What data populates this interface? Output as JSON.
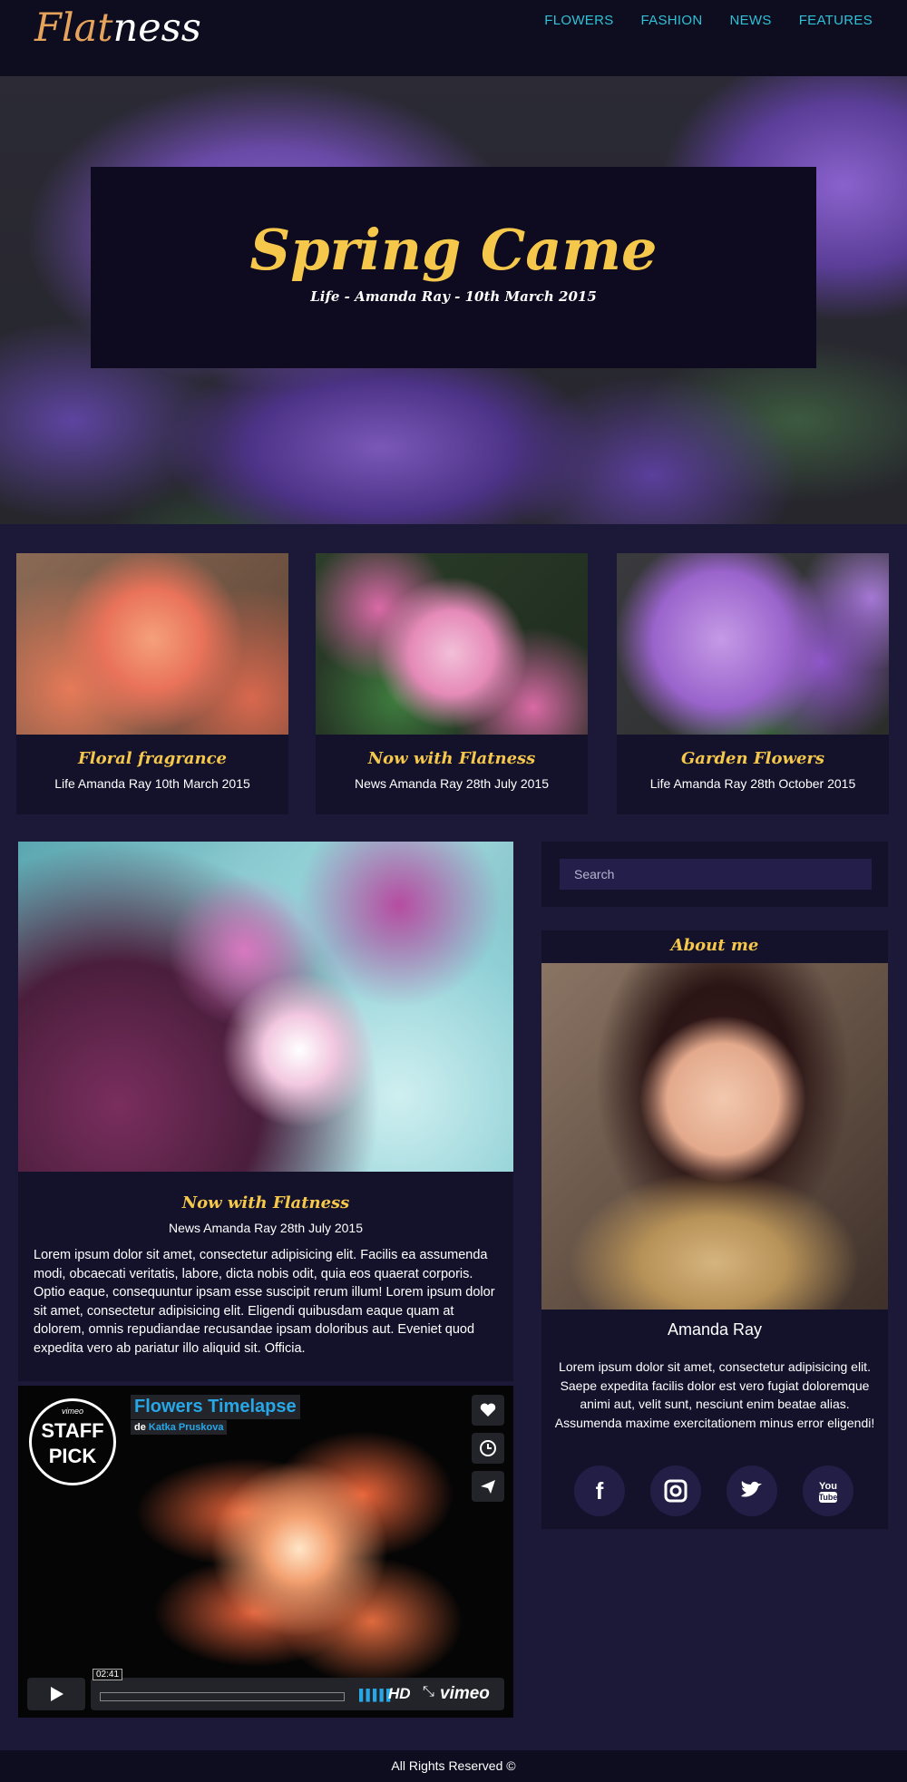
{
  "header": {
    "logo_part1": "Flat",
    "logo_part2": "ness",
    "nav": [
      "FLOWERS",
      "FASHION",
      "NEWS",
      "FEATURES"
    ]
  },
  "hero": {
    "title": "Spring Came",
    "subtitle": "Life - Amanda Ray - 10th March 2015"
  },
  "cards": [
    {
      "title": "Floral fragrance",
      "meta": "Life Amanda Ray 10th March 2015"
    },
    {
      "title": "Now with Flatness",
      "meta": "News Amanda Ray 28th July 2015"
    },
    {
      "title": "Garden Flowers",
      "meta": "Life Amanda Ray 28th October 2015"
    }
  ],
  "post": {
    "title": "Now with Flatness",
    "meta": "News Amanda Ray 28th July 2015",
    "body": "Lorem ipsum dolor sit amet, consectetur adipisicing elit. Facilis ea assumenda modi, obcaecati veritatis, labore, dicta nobis odit, quia eos quaerat corporis. Optio eaque, consequuntur ipsam esse suscipit rerum illum! Lorem ipsum dolor sit amet, consectetur adipisicing elit. Eligendi quibusdam eaque quam at dolorem, omnis repudiandae recusandae ipsam doloribus aut. Eveniet quod expedita vero ab pariatur illo aliquid sit. Officia."
  },
  "video": {
    "staff_top": "vimeo",
    "staff_line1": "STAFF",
    "staff_line2": "PICK",
    "title": "Flowers Timelapse",
    "by_prefix": "de",
    "author": "Katka Pruskova",
    "time": "02:41",
    "hd": "HD",
    "brand": "vimeo"
  },
  "sidebar": {
    "search_placeholder": "Search",
    "about_title": "About me",
    "name": "Amanda Ray",
    "description": "Lorem ipsum dolor sit amet, consectetur adipisicing elit. Saepe expedita facilis dolor est vero fugiat doloremque animi aut, velit sunt, nesciunt enim beatae alias. Assumenda maxime exercitationem minus error eligendi!",
    "socials": [
      {
        "icon": "facebook-icon",
        "glyph": "f"
      },
      {
        "icon": "instagram-icon",
        "glyph": "◘"
      },
      {
        "icon": "twitter-icon",
        "glyph": "🐦"
      },
      {
        "icon": "youtube-icon",
        "glyph": "You Tube"
      }
    ]
  },
  "footer": {
    "text": "All Rights Reserved ©"
  },
  "colors": {
    "accent_yellow": "#f5c84c",
    "nav_cyan": "#2fc1d6",
    "logo_orange": "#e6a35c",
    "background": "#1c1838",
    "panel": "#14112b"
  }
}
